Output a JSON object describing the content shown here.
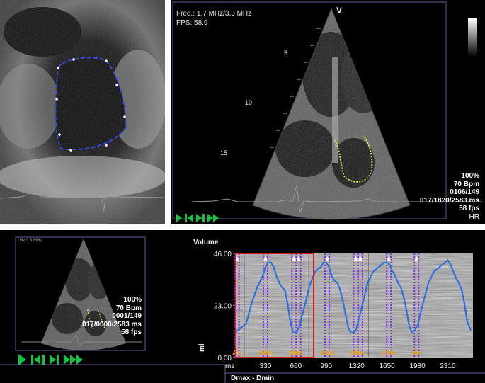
{
  "left_panel": {
    "view": "ultrasound-zoom-view"
  },
  "right_panel": {
    "freq": "Freq.: 1.7 MHz/3.3 MHz",
    "fps_label": "FPS: 58.9",
    "orientation_marker": "V",
    "depth_marks": [
      "5",
      "10",
      "15"
    ],
    "info": [
      "100%",
      "70 Bpm",
      "0106/149",
      "017/1820/2583 ms",
      "58 fps",
      "HR"
    ]
  },
  "bottom_panel": {
    "thumb_header": "Hz/3.3 MHz",
    "info": [
      "100%",
      "70 Bpm",
      "0001/149",
      "017/0000/2583 ms",
      "58 fps"
    ],
    "footer_label": "Dmax - Dmin"
  },
  "chart_data": {
    "type": "line",
    "title": "Volume",
    "ylabel": "ml",
    "xlabel": "ms",
    "ylim": [
      0,
      46
    ],
    "xlim": [
      0,
      2583
    ],
    "y_ticks": [
      "46.00",
      "23.00",
      "0.00"
    ],
    "x_ticks": [
      "ms",
      "330",
      "660",
      "990",
      "1320",
      "1650",
      "1980",
      "2310"
    ],
    "x_tick_values": [
      0,
      330,
      660,
      990,
      1320,
      1650,
      1980,
      2310
    ],
    "event_labels": [
      {
        "label": "Ao",
        "x": 20
      },
      {
        "label": "AMo",
        "x": 330
      },
      {
        "label": "Mc",
        "x": 640
      },
      {
        "label": "Ao",
        "x": 690
      },
      {
        "label": "AMo",
        "x": 1000
      },
      {
        "label": "Mc",
        "x": 1310
      },
      {
        "label": "Ao",
        "x": 1360
      },
      {
        "label": "AMo",
        "x": 1670
      },
      {
        "label": "Mc",
        "x": 1970
      }
    ],
    "series": [
      {
        "color": "#2f6fe0",
        "x": [
          0,
          60,
          120,
          180,
          240,
          300,
          330,
          360,
          390,
          420,
          450,
          480,
          510,
          540,
          570,
          600,
          630,
          660,
          690,
          750,
          810,
          870,
          930,
          960,
          990,
          1020,
          1050,
          1080,
          1110,
          1140,
          1170,
          1200,
          1230,
          1260,
          1290,
          1320,
          1380,
          1440,
          1500,
          1560,
          1620,
          1650,
          1680,
          1710,
          1740,
          1770,
          1800,
          1830,
          1860,
          1890,
          1920,
          1950,
          1980,
          2040,
          2100,
          2160,
          2220,
          2280,
          2310,
          2340,
          2370,
          2400,
          2430,
          2460,
          2490,
          2520,
          2560
        ],
        "values": [
          11,
          13,
          15,
          24,
          31,
          36,
          40,
          42,
          42,
          40,
          36,
          33,
          31,
          30,
          24,
          16,
          11,
          11,
          13,
          22,
          32,
          38,
          40,
          42,
          42,
          40,
          36,
          34,
          33,
          30,
          25,
          19,
          13,
          11,
          11,
          13,
          23,
          33,
          38,
          40,
          42,
          42,
          41,
          38,
          36,
          33,
          31,
          27,
          21,
          14,
          11,
          12,
          14,
          24,
          33,
          38,
          40,
          42,
          43,
          41,
          38,
          35,
          33,
          30,
          24,
          16,
          12
        ]
      }
    ]
  },
  "colors": {
    "accent_green": "#16c040",
    "trace_blue": "#2f6fe0",
    "marker_purple": "#7b2fd0",
    "label_orange": "#e8a020",
    "frame_red": "#d62020"
  }
}
